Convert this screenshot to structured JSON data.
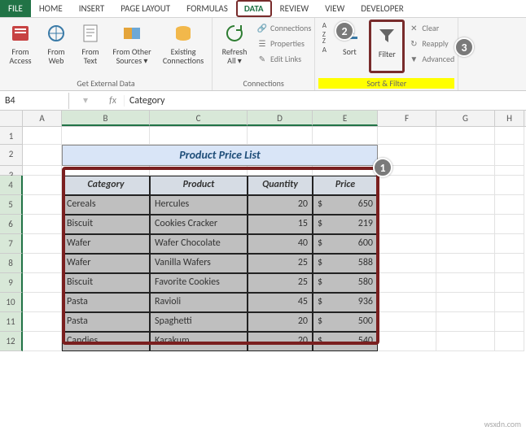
{
  "ribbon": {
    "tabs": [
      "FILE",
      "HOME",
      "INSERT",
      "PAGE LAYOUT",
      "FORMULAS",
      "DATA",
      "REVIEW",
      "VIEW",
      "DEVELOPER"
    ],
    "active_tab": "DATA",
    "groups": {
      "external": {
        "label": "Get External Data",
        "btns": {
          "access": "From Access",
          "web": "From Web",
          "text": "From Text",
          "other": "From Other Sources ▾",
          "existing": "Existing Connections"
        }
      },
      "connections": {
        "label": "Connections",
        "refresh": "Refresh All ▾",
        "conn": "Connections",
        "props": "Properties",
        "edit": "Edit Links"
      },
      "sortfilter": {
        "label": "Sort & Filter",
        "sort_small": "A→Z",
        "sort_small2": "Z→A",
        "sort": "Sort",
        "filter": "Filter",
        "clear": "Clear",
        "reapply": "Reapply",
        "advanced": "Advanced"
      }
    }
  },
  "namebox": "B4",
  "formula": "Category",
  "columns": [
    "A",
    "B",
    "C",
    "D",
    "E",
    "F",
    "G",
    "H"
  ],
  "title": "Product Price List",
  "table": {
    "headers": [
      "Category",
      "Product",
      "Quantity",
      "Price"
    ],
    "rows": [
      {
        "cat": "Cereals",
        "prod": "Hercules",
        "qty": "20",
        "cur": "$",
        "price": "650"
      },
      {
        "cat": "Biscuit",
        "prod": "Cookies Cracker",
        "qty": "15",
        "cur": "$",
        "price": "219"
      },
      {
        "cat": "Wafer",
        "prod": "Wafer Chocolate",
        "qty": "40",
        "cur": "$",
        "price": "600"
      },
      {
        "cat": "Wafer",
        "prod": "Vanilla Wafers",
        "qty": "25",
        "cur": "$",
        "price": "588"
      },
      {
        "cat": "Biscuit",
        "prod": "Favorite Cookies",
        "qty": "25",
        "cur": "$",
        "price": "580"
      },
      {
        "cat": "Pasta",
        "prod": "Ravioli",
        "qty": "45",
        "cur": "$",
        "price": "936"
      },
      {
        "cat": "Pasta",
        "prod": "Spaghetti",
        "qty": "20",
        "cur": "$",
        "price": "500"
      },
      {
        "cat": "Candies",
        "prod": "Karakum",
        "qty": "20",
        "cur": "$",
        "price": "540"
      }
    ]
  },
  "badges": {
    "1": "1",
    "2": "2",
    "3": "3"
  },
  "credit": "wsxdn.com",
  "chart_data": {
    "type": "table",
    "title": "Product Price List",
    "columns": [
      "Category",
      "Product",
      "Quantity",
      "Price"
    ],
    "rows": [
      [
        "Cereals",
        "Hercules",
        20,
        650
      ],
      [
        "Biscuit",
        "Cookies Cracker",
        15,
        219
      ],
      [
        "Wafer",
        "Wafer Chocolate",
        40,
        600
      ],
      [
        "Wafer",
        "Vanilla Wafers",
        25,
        588
      ],
      [
        "Biscuit",
        "Favorite Cookies",
        25,
        580
      ],
      [
        "Pasta",
        "Ravioli",
        45,
        936
      ],
      [
        "Pasta",
        "Spaghetti",
        20,
        500
      ],
      [
        "Candies",
        "Karakum",
        20,
        540
      ]
    ]
  }
}
